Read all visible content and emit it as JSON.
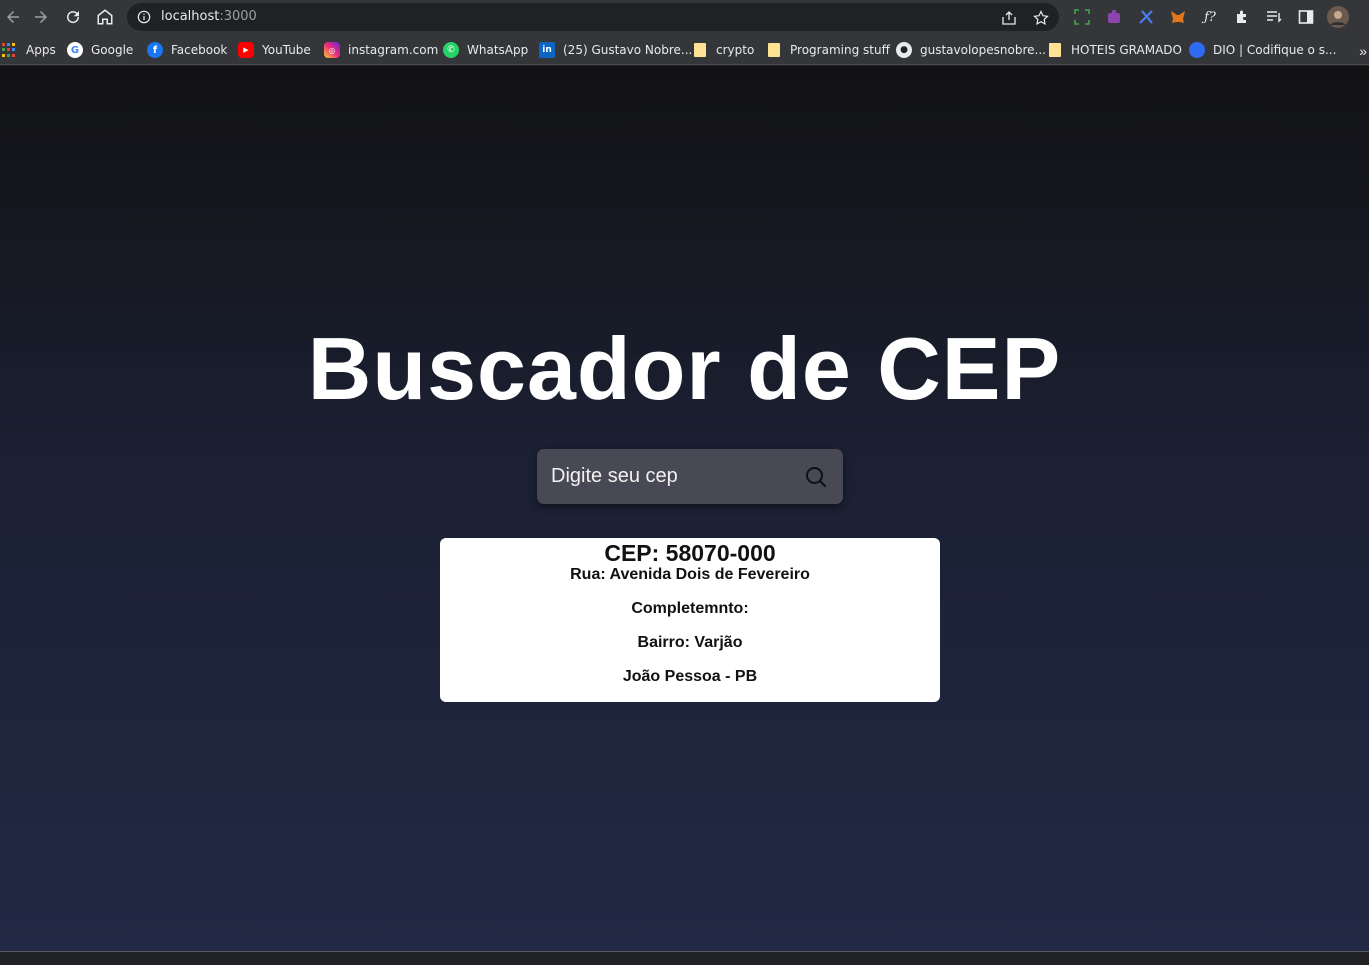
{
  "browser": {
    "url_host": "localhost",
    "url_port": ":3000",
    "bookmarks": [
      {
        "label": "Apps",
        "icon": "apps-grid-icon"
      },
      {
        "label": "Google",
        "icon": "google-icon"
      },
      {
        "label": "Facebook",
        "icon": "facebook-icon"
      },
      {
        "label": "YouTube",
        "icon": "youtube-icon"
      },
      {
        "label": "instagram.com",
        "icon": "instagram-icon"
      },
      {
        "label": "WhatsApp",
        "icon": "whatsapp-icon"
      },
      {
        "label": "(25) Gustavo Nobre...",
        "icon": "linkedin-icon"
      },
      {
        "label": "crypto",
        "icon": "folder-icon"
      },
      {
        "label": "Programing stuff",
        "icon": "folder-icon"
      },
      {
        "label": "gustavolopesnobre...",
        "icon": "github-icon"
      },
      {
        "label": "HOTEIS GRAMADO",
        "icon": "folder-icon"
      },
      {
        "label": "DIO | Codifique o s...",
        "icon": "dio-icon"
      }
    ],
    "more_label": "»"
  },
  "page": {
    "title": "Buscador de CEP",
    "search": {
      "placeholder": "Digite seu cep",
      "value": ""
    },
    "result": {
      "cep": "CEP: 58070-000",
      "rua": "Rua: Avenida Dois de Fevereiro",
      "complemento": "Completemnto:",
      "bairro": "Bairro: Varjão",
      "cidade": "João Pessoa - PB"
    }
  }
}
